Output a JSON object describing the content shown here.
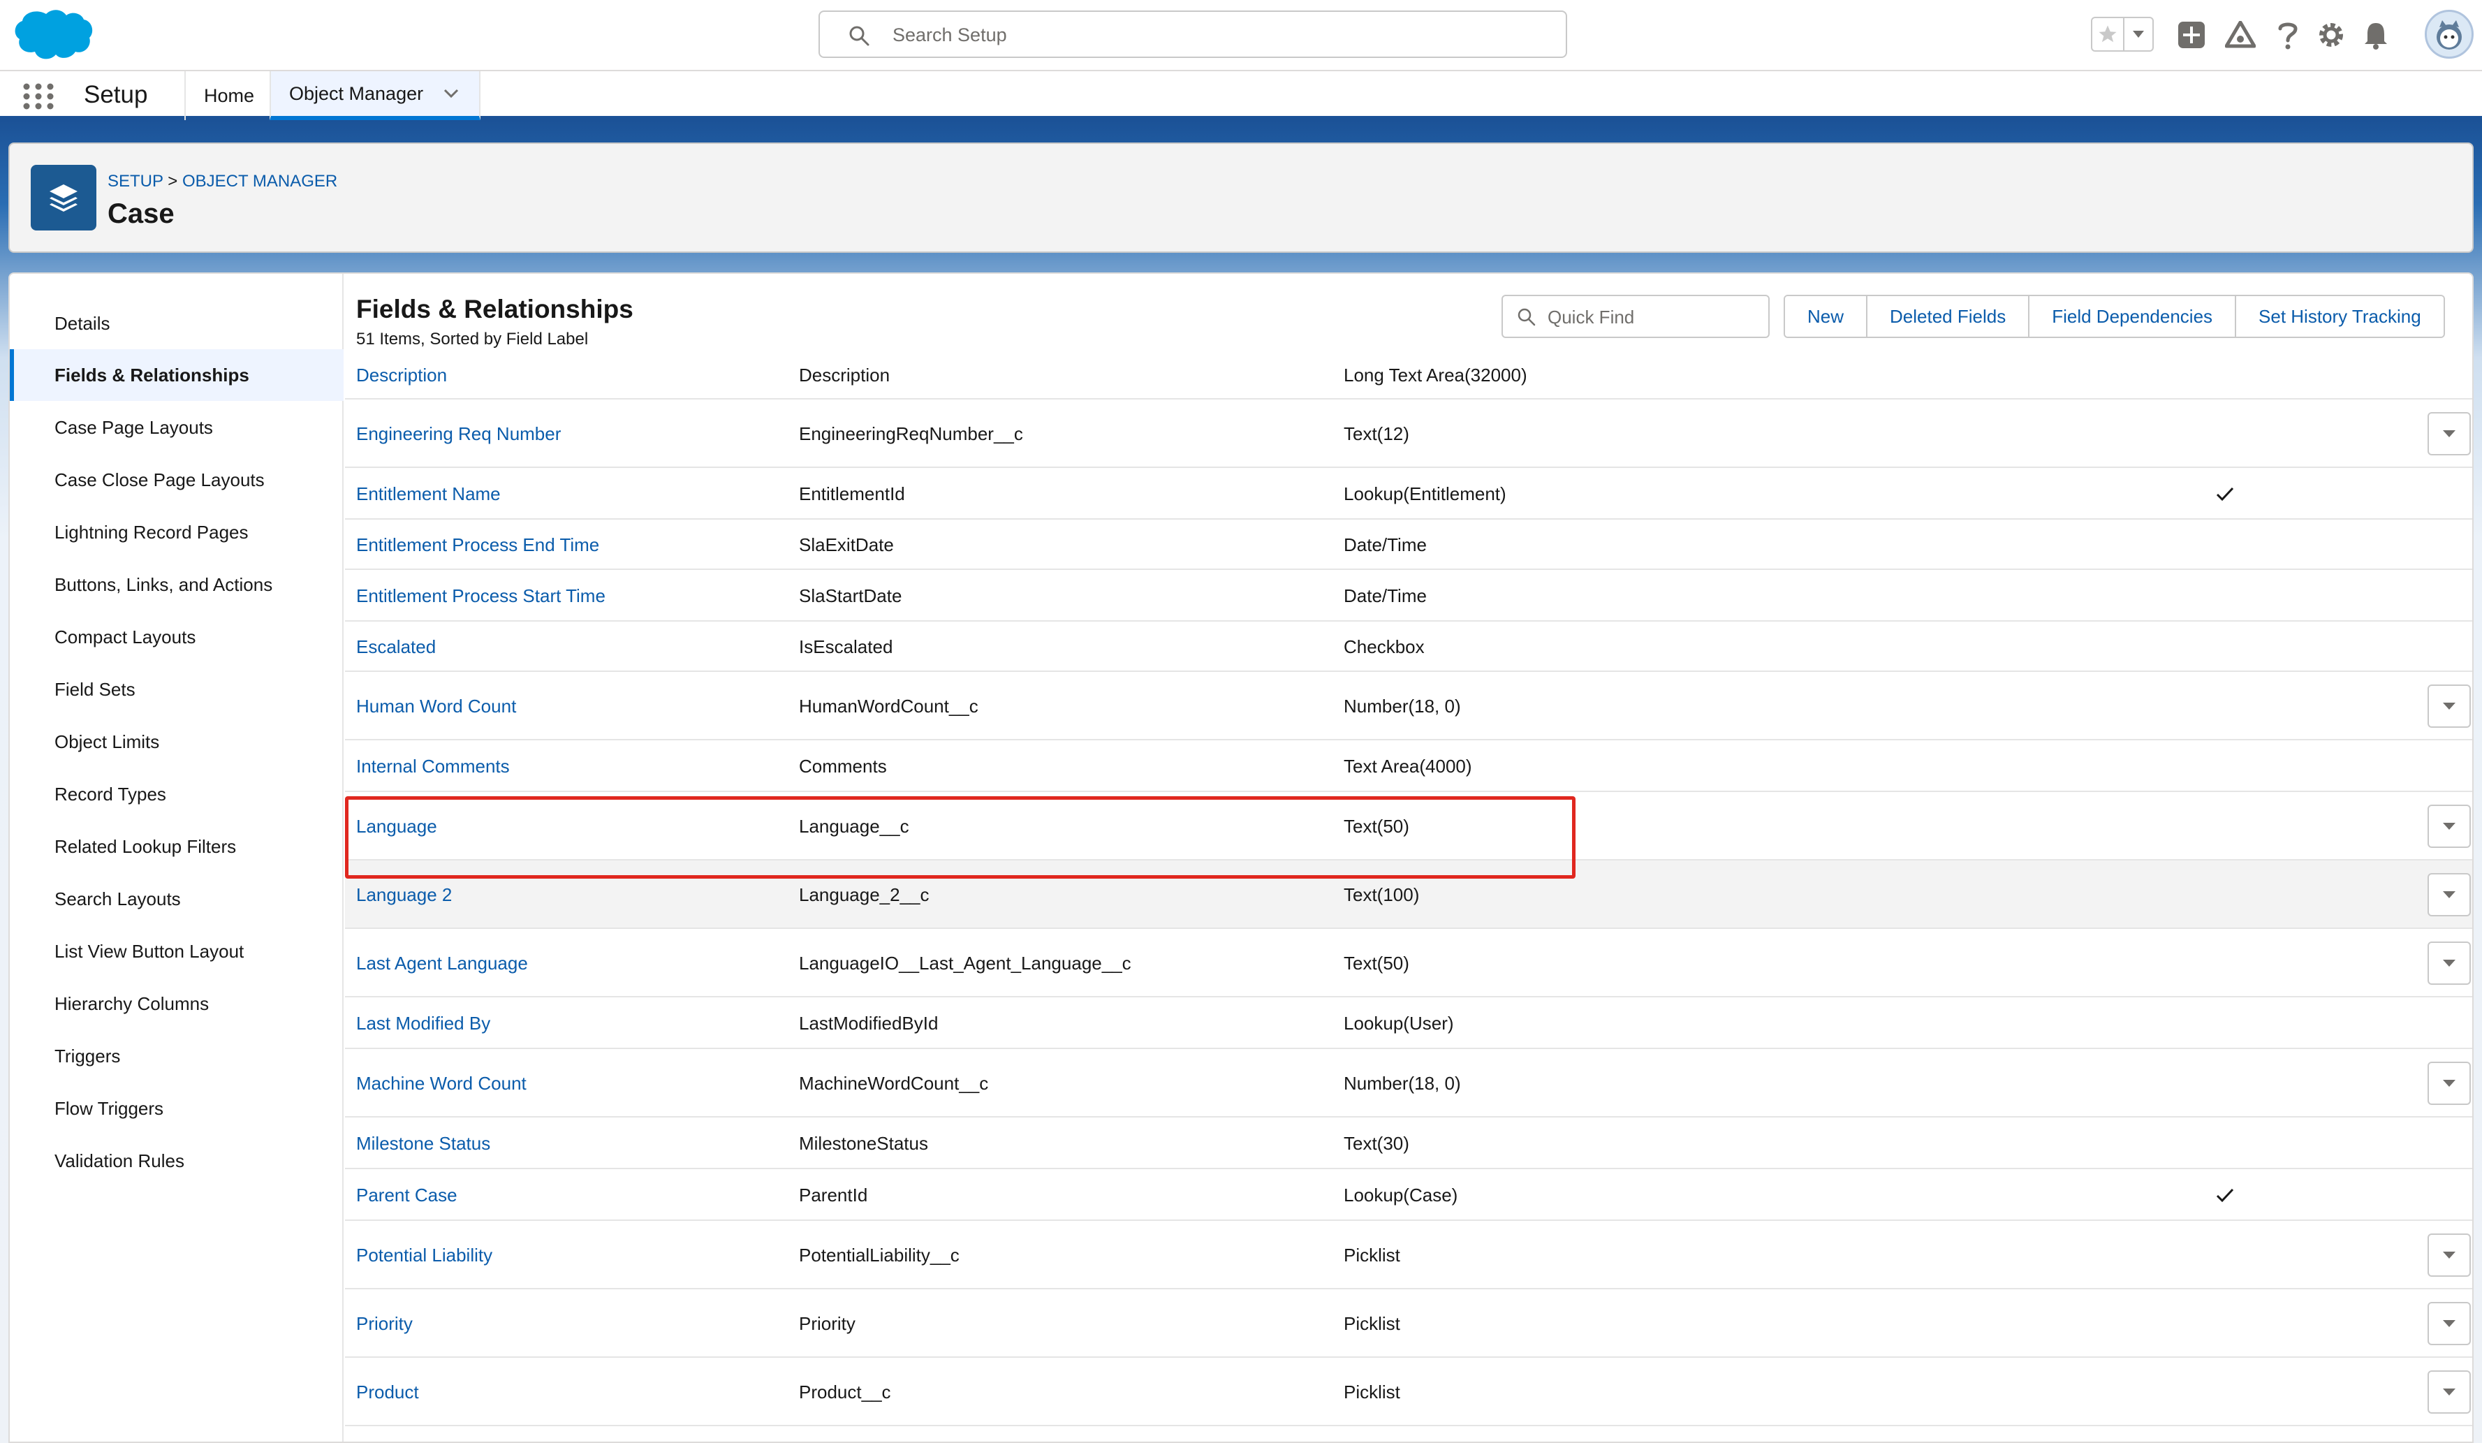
{
  "header": {
    "search_placeholder": "Search Setup",
    "icons": [
      "favorites-star-icon",
      "favorites-dropdown-icon",
      "global-add-icon",
      "trailhead-icon",
      "help-icon",
      "setup-gear-icon",
      "notifications-bell-icon",
      "user-avatar"
    ]
  },
  "context_bar": {
    "app_name": "Setup",
    "tabs": [
      {
        "label": "Home"
      },
      {
        "label": "Object Manager"
      }
    ]
  },
  "page_header": {
    "breadcrumb_setup": "SETUP",
    "breadcrumb_sep": ">",
    "breadcrumb_object_manager": "OBJECT MANAGER",
    "title": "Case"
  },
  "sidebar": {
    "items": [
      {
        "label": "Details"
      },
      {
        "label": "Fields & Relationships"
      },
      {
        "label": "Case Page Layouts"
      },
      {
        "label": "Case Close Page Layouts"
      },
      {
        "label": "Lightning Record Pages"
      },
      {
        "label": "Buttons, Links, and Actions"
      },
      {
        "label": "Compact Layouts"
      },
      {
        "label": "Field Sets"
      },
      {
        "label": "Object Limits"
      },
      {
        "label": "Record Types"
      },
      {
        "label": "Related Lookup Filters"
      },
      {
        "label": "Search Layouts"
      },
      {
        "label": "List View Button Layout"
      },
      {
        "label": "Hierarchy Columns"
      },
      {
        "label": "Triggers"
      },
      {
        "label": "Flow Triggers"
      },
      {
        "label": "Validation Rules"
      }
    ]
  },
  "section": {
    "title": "Fields & Relationships",
    "subtitle": "51 Items, Sorted by Field Label",
    "quick_find_placeholder": "Quick Find",
    "buttons": {
      "new": "New",
      "deleted_fields": "Deleted Fields",
      "field_dependencies": "Field Dependencies",
      "set_history_tracking": "Set History Tracking"
    }
  },
  "fields": [
    {
      "label": "Description",
      "api": "Description",
      "type": "Long Text Area(32000)",
      "indexed": false,
      "action": false
    },
    {
      "label": "Engineering Req Number",
      "api": "EngineeringReqNumber__c",
      "type": "Text(12)",
      "indexed": false,
      "action": true
    },
    {
      "label": "Entitlement Name",
      "api": "EntitlementId",
      "type": "Lookup(Entitlement)",
      "indexed": true,
      "action": false
    },
    {
      "label": "Entitlement Process End Time",
      "api": "SlaExitDate",
      "type": "Date/Time",
      "indexed": false,
      "action": false
    },
    {
      "label": "Entitlement Process Start Time",
      "api": "SlaStartDate",
      "type": "Date/Time",
      "indexed": false,
      "action": false
    },
    {
      "label": "Escalated",
      "api": "IsEscalated",
      "type": "Checkbox",
      "indexed": false,
      "action": false
    },
    {
      "label": "Human Word Count",
      "api": "HumanWordCount__c",
      "type": "Number(18, 0)",
      "indexed": false,
      "action": true
    },
    {
      "label": "Internal Comments",
      "api": "Comments",
      "type": "Text Area(4000)",
      "indexed": false,
      "action": false
    },
    {
      "label": "Language",
      "api": "Language__c",
      "type": "Text(50)",
      "indexed": false,
      "action": true
    },
    {
      "label": "Language 2",
      "api": "Language_2__c",
      "type": "Text(100)",
      "indexed": false,
      "action": true
    },
    {
      "label": "Last Agent Language",
      "api": "LanguageIO__Last_Agent_Language__c",
      "type": "Text(50)",
      "indexed": false,
      "action": true
    },
    {
      "label": "Last Modified By",
      "api": "LastModifiedById",
      "type": "Lookup(User)",
      "indexed": false,
      "action": false
    },
    {
      "label": "Machine Word Count",
      "api": "MachineWordCount__c",
      "type": "Number(18, 0)",
      "indexed": false,
      "action": true
    },
    {
      "label": "Milestone Status",
      "api": "MilestoneStatus",
      "type": "Text(30)",
      "indexed": false,
      "action": false
    },
    {
      "label": "Parent Case",
      "api": "ParentId",
      "type": "Lookup(Case)",
      "indexed": true,
      "action": false
    },
    {
      "label": "Potential Liability",
      "api": "PotentialLiability__c",
      "type": "Picklist",
      "indexed": false,
      "action": true
    },
    {
      "label": "Priority",
      "api": "Priority",
      "type": "Picklist",
      "indexed": false,
      "action": true
    },
    {
      "label": "Product",
      "api": "Product__c",
      "type": "Picklist",
      "indexed": false,
      "action": true
    }
  ],
  "colors": {
    "brand_blue": "#0176d3",
    "link_blue": "#0b5cab",
    "highlight_red": "#e0271f"
  }
}
